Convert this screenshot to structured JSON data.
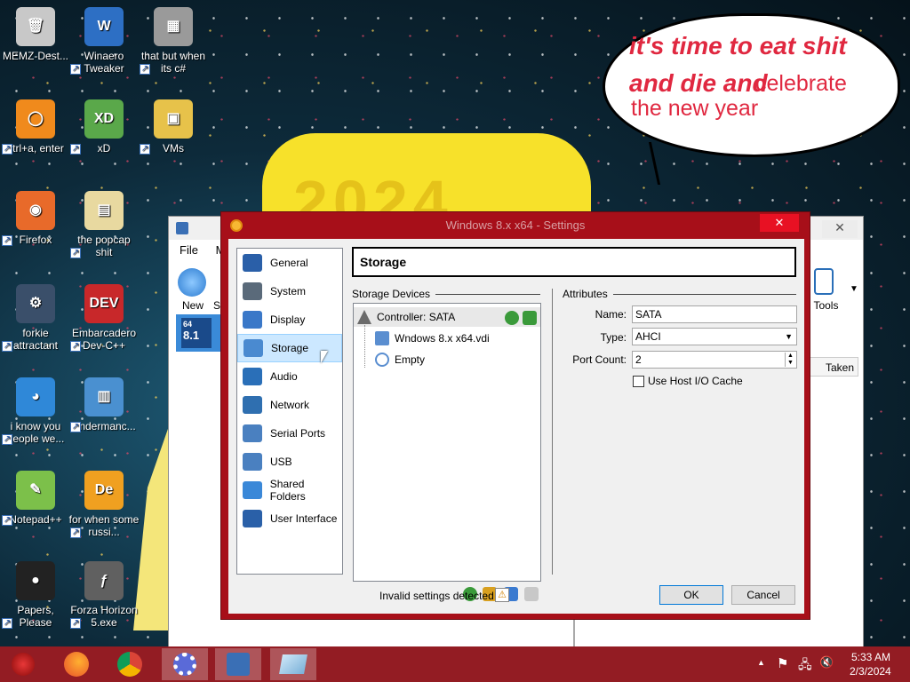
{
  "desktop": {
    "icons": [
      {
        "label": "MEMZ-Dest...",
        "color": "#c8c8c8",
        "glyph": "🗑"
      },
      {
        "label": "Winaero Tweaker",
        "color": "#2d6fc4",
        "glyph": "W"
      },
      {
        "label": "that but when its c#",
        "color": "#9a9a9a",
        "glyph": "▦"
      },
      {
        "label": "ctrl+a, enter",
        "color": "#f08a1c",
        "glyph": "◯"
      },
      {
        "label": "xD",
        "color": "#5aa84a",
        "glyph": "XD"
      },
      {
        "label": "VMs",
        "color": "#e7c24a",
        "glyph": "▣"
      },
      {
        "label": "Firefox",
        "color": "#e86a2a",
        "glyph": "◉"
      },
      {
        "label": "the popcap shit",
        "color": "#e8d9a0",
        "glyph": "▤"
      },
      {
        "label": "forkie attractant",
        "color": "#3a4f6a",
        "glyph": "⚙"
      },
      {
        "label": "Embarcadero Dev-C++",
        "color": "#c8282a",
        "glyph": "DEV"
      },
      {
        "label": "i know you people we...",
        "color": "#2f88d8",
        "glyph": "◕"
      },
      {
        "label": "Endermanc...",
        "color": "#4a90d0",
        "glyph": "▥"
      },
      {
        "label": "Notepad++",
        "color": "#7cc04a",
        "glyph": "✎"
      },
      {
        "label": "for when some russi...",
        "color": "#f0a020",
        "glyph": "De"
      },
      {
        "label": "Papers, Please",
        "color": "#222",
        "glyph": "●"
      },
      {
        "label": "Forza Horizon 5.exe",
        "color": "#606060",
        "glyph": "ƒ"
      }
    ],
    "bubble_lines": [
      "it's time to eat shit",
      "and die and",
      "celebrate",
      "the new year"
    ],
    "yellow_sign": "2024"
  },
  "bg_window": {
    "menu_file": "File",
    "menu_m": "M",
    "new_label": "New",
    "se_label": "Se",
    "tools_label": "al Tools",
    "taken_label": "Taken",
    "vm_badge": "8.1",
    "vm_badge_top": "64",
    "close_glyph": "✕"
  },
  "dialog": {
    "title": "Windows 8.x x64 - Settings",
    "close_glyph": "✕",
    "categories": [
      {
        "label": "General",
        "color": "#2a5fa8"
      },
      {
        "label": "System",
        "color": "#5a6a7a"
      },
      {
        "label": "Display",
        "color": "#3a78c8"
      },
      {
        "label": "Storage",
        "color": "#4a8ad0",
        "selected": true
      },
      {
        "label": "Audio",
        "color": "#2a6fb8"
      },
      {
        "label": "Network",
        "color": "#2f6fb0"
      },
      {
        "label": "Serial Ports",
        "color": "#4a80c0"
      },
      {
        "label": "USB",
        "color": "#4a80c0"
      },
      {
        "label": "Shared Folders",
        "color": "#3a88d8"
      },
      {
        "label": "User Interface",
        "color": "#2a60a8"
      }
    ],
    "header": "Storage",
    "storage_devices_label": "Storage Devices",
    "attributes_label": "Attributes",
    "tree": {
      "controller": "Controller: SATA",
      "disk": "Wndows 8.x x64.vdi",
      "optical": "Empty"
    },
    "attributes": {
      "name_label": "Name:",
      "name_value": "SATA",
      "type_label": "Type:",
      "type_value": "AHCI",
      "port_label": "Port Count:",
      "port_value": "2",
      "cache_label": "Use Host I/O Cache",
      "cache_checked": false
    },
    "invalid_text": "Invalid settings detected",
    "ok": "OK",
    "cancel": "Cancel"
  },
  "taskbar": {
    "time": "5:33 AM",
    "date": "2/3/2024",
    "arrow_glyph": "▲",
    "flag_glyph": "⚑",
    "net_glyph": "🖧",
    "vol_glyph": "🔇"
  }
}
